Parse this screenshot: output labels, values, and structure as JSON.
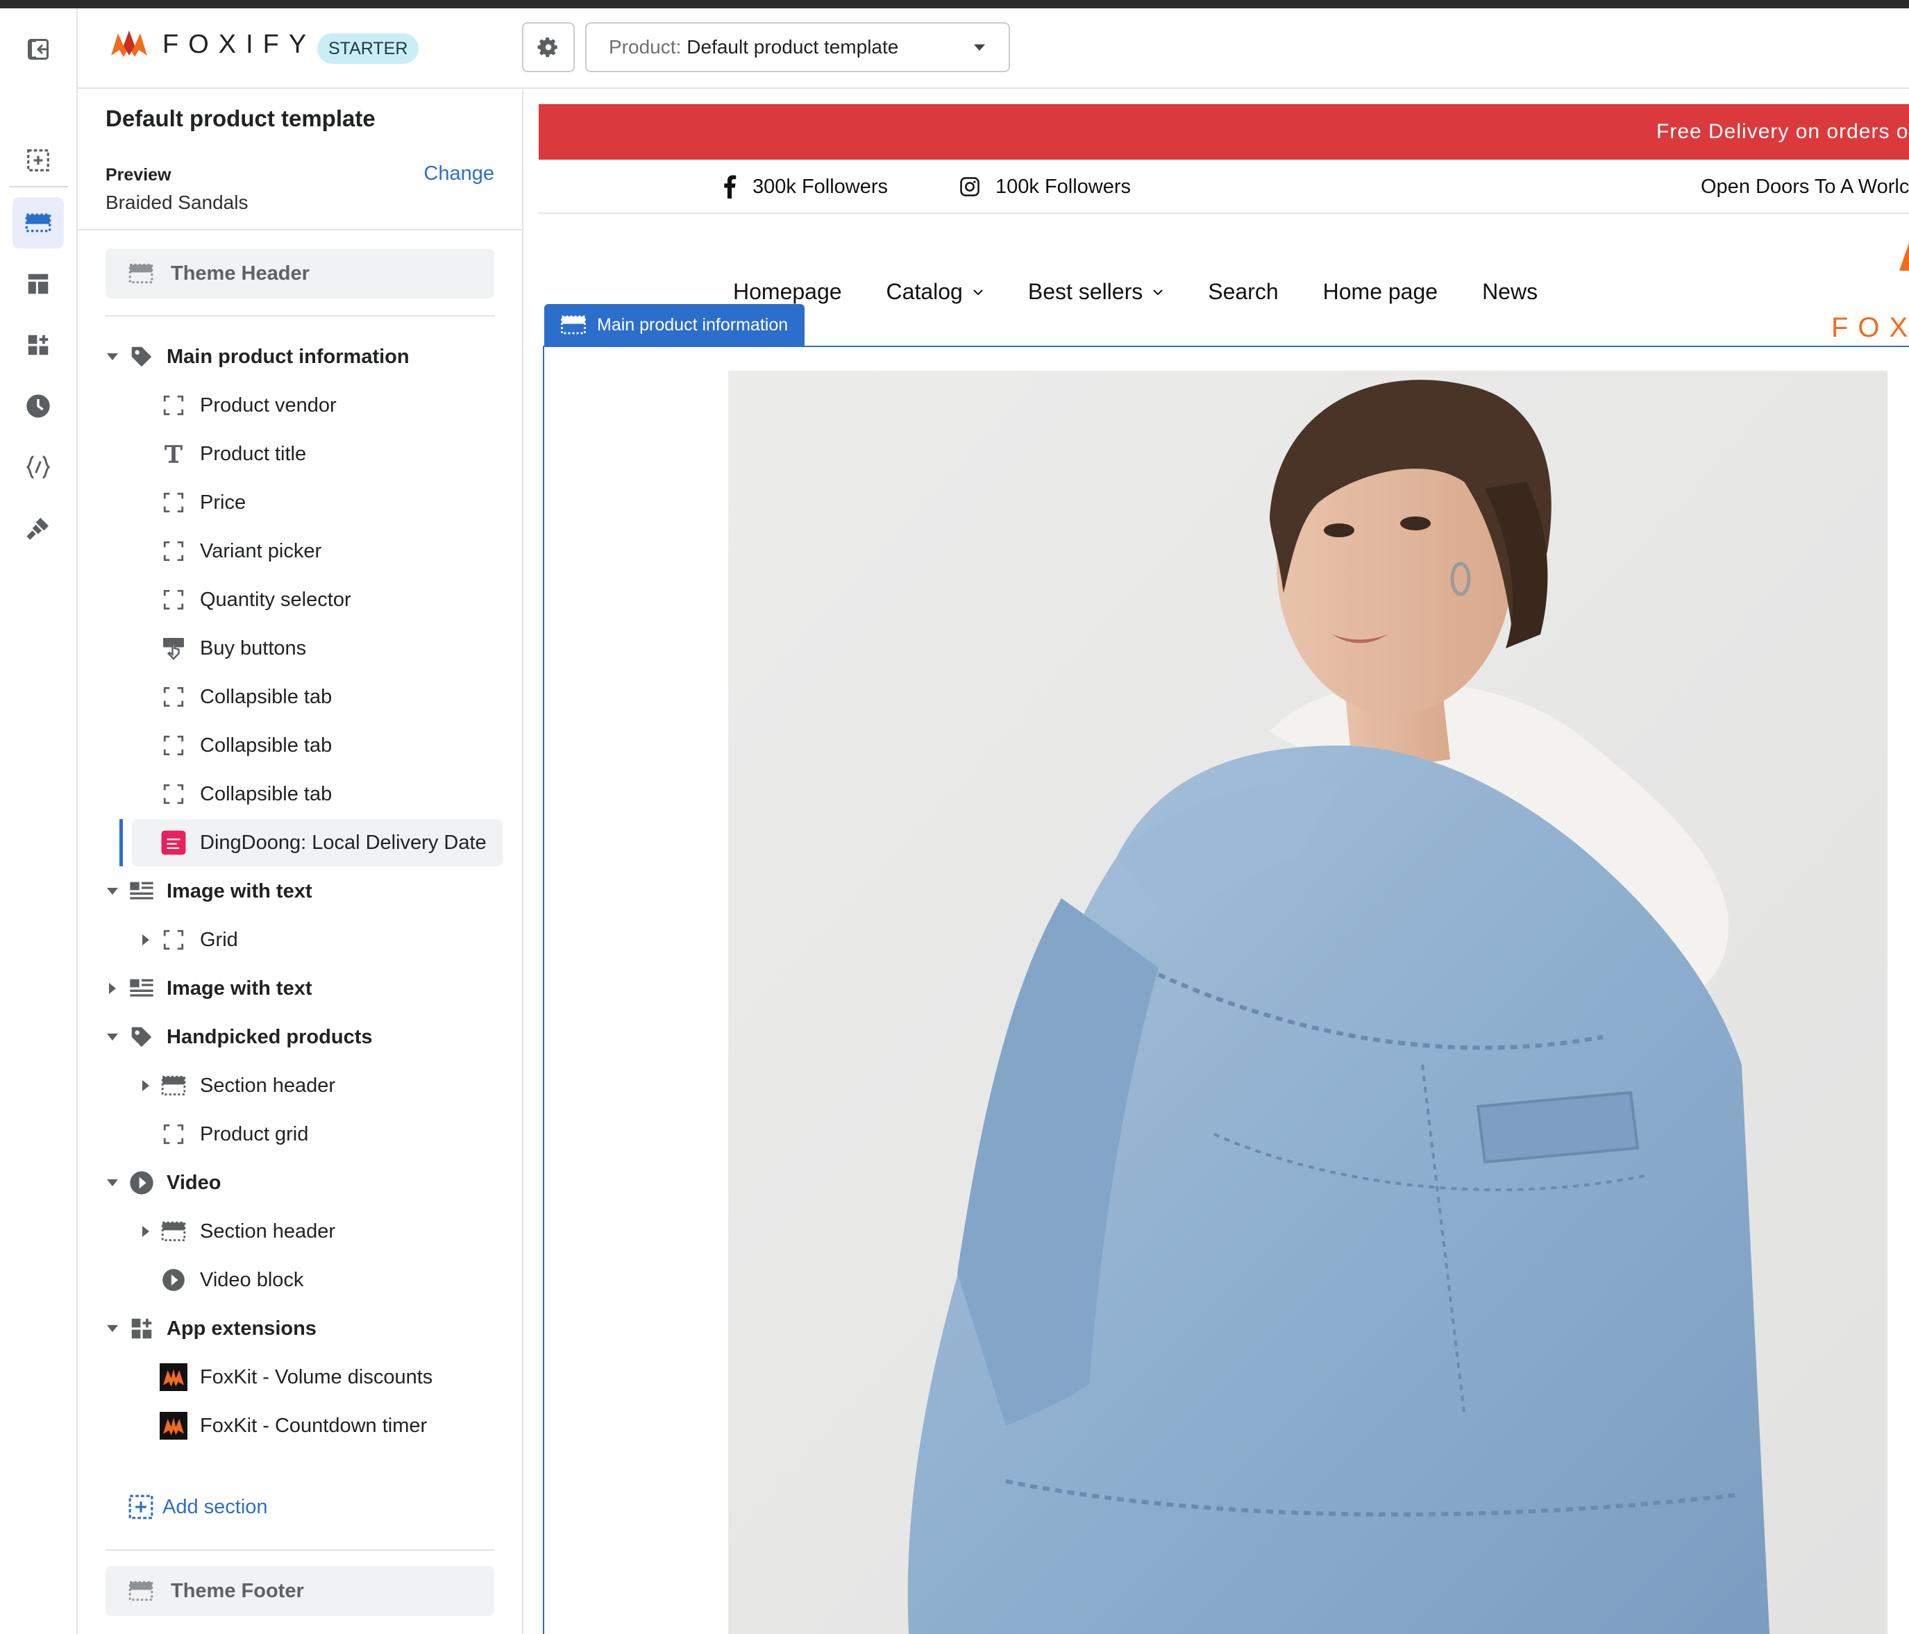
{
  "app": {
    "brand": "FOXIFY",
    "plan_badge": "STARTER",
    "template_selector": {
      "label": "Product:",
      "value": "Default product template"
    }
  },
  "rail": {
    "icons": [
      "exit-icon",
      "add-section-icon",
      "sections-icon",
      "layout-icon",
      "apps-icon",
      "history-icon",
      "code-icon",
      "brush-icon"
    ],
    "active_icon": "sections-icon"
  },
  "sidebar": {
    "title": "Default product template",
    "preview_label": "Preview",
    "preview_value": "Braided Sandals",
    "change_label": "Change",
    "theme_header": "Theme Header",
    "theme_footer": "Theme Footer",
    "add_section": "Add section",
    "tree": [
      {
        "label": "Main product information",
        "level": 0,
        "icon": "tag-icon",
        "expanded": true
      },
      {
        "label": "Product vendor",
        "level": 1,
        "icon": "block-icon"
      },
      {
        "label": "Product title",
        "level": 1,
        "icon": "text-icon"
      },
      {
        "label": "Price",
        "level": 1,
        "icon": "block-icon"
      },
      {
        "label": "Variant picker",
        "level": 1,
        "icon": "block-icon"
      },
      {
        "label": "Quantity selector",
        "level": 1,
        "icon": "block-icon"
      },
      {
        "label": "Buy buttons",
        "level": 1,
        "icon": "buy-button-icon"
      },
      {
        "label": "Collapsible tab",
        "level": 1,
        "icon": "block-icon"
      },
      {
        "label": "Collapsible tab",
        "level": 1,
        "icon": "block-icon"
      },
      {
        "label": "Collapsible tab",
        "level": 1,
        "icon": "block-icon"
      },
      {
        "label": "DingDoong: Local Delivery Date",
        "level": 1,
        "icon": "dingdoong-app-icon",
        "selected": true
      },
      {
        "label": "Image with text",
        "level": 0,
        "icon": "image-text-icon",
        "expanded": true
      },
      {
        "label": "Grid",
        "level": 1,
        "icon": "block-icon",
        "collapsed_children": true
      },
      {
        "label": "Image with text",
        "level": 0,
        "icon": "image-text-icon",
        "expanded": false
      },
      {
        "label": "Handpicked products",
        "level": 0,
        "icon": "tag-icon",
        "expanded": true
      },
      {
        "label": "Section header",
        "level": 1,
        "icon": "section-header-icon",
        "collapsed_children": true
      },
      {
        "label": "Product grid",
        "level": 1,
        "icon": "block-icon"
      },
      {
        "label": "Video",
        "level": 0,
        "icon": "play-icon",
        "expanded": true
      },
      {
        "label": "Section header",
        "level": 1,
        "icon": "section-header-icon",
        "collapsed_children": true
      },
      {
        "label": "Video block",
        "level": 1,
        "icon": "play-icon"
      },
      {
        "label": "App extensions",
        "level": 0,
        "icon": "apps-icon",
        "expanded": true
      },
      {
        "label": "FoxKit - Volume discounts",
        "level": 1,
        "icon": "foxkit-app-icon"
      },
      {
        "label": "FoxKit - Countdown timer",
        "level": 1,
        "icon": "foxkit-app-icon"
      }
    ]
  },
  "preview": {
    "announcement": "Free Delivery on orders ove",
    "facebook_followers": "300k Followers",
    "instagram_followers": "100k Followers",
    "tagline": "Open Doors To A Worlc",
    "nav": [
      {
        "label": "Homepage",
        "dropdown": false
      },
      {
        "label": "Catalog",
        "dropdown": true
      },
      {
        "label": "Best sellers",
        "dropdown": true
      },
      {
        "label": "Search",
        "dropdown": false
      },
      {
        "label": "Home page",
        "dropdown": false
      },
      {
        "label": "News",
        "dropdown": false
      }
    ],
    "brand_partial": "FOX",
    "section_tag": "Main product information",
    "image_subject": "model-in-denim-jacket"
  },
  "colors": {
    "accent": "#2c6ecb",
    "announcement_bg": "#db3a3c",
    "brand_orange": "#f26b1d",
    "badge_bg": "#c9eef5"
  }
}
